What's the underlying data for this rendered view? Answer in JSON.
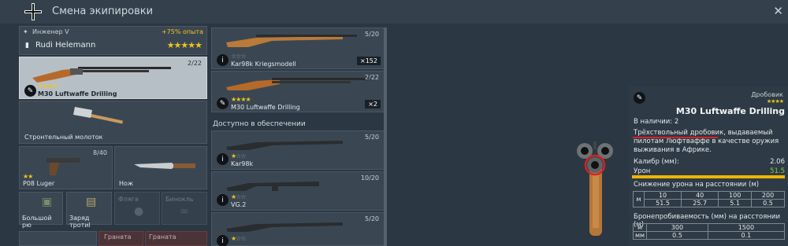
{
  "window": {
    "title": "Смена экипировки"
  },
  "soldier": {
    "role": "Инженер V",
    "exp_bonus": "+75% опыта",
    "name": "Rudi Helemann"
  },
  "loadout": {
    "primary": {
      "name": "M30 Luftwaffe Drilling",
      "ammo": "2/22"
    },
    "melee": {
      "name": "Стронтельный молоток"
    },
    "sidearm": {
      "name": "P08 Luger",
      "ammo": "8/40"
    },
    "knife": {
      "name": "Нож"
    },
    "slots": [
      {
        "name": "Большой рю",
        "icon": "backpack-icon"
      },
      {
        "name": "Заряд тротиl",
        "icon": "explosive-icon"
      },
      {
        "name": "Фляга",
        "icon": "flask-icon"
      },
      {
        "name": "Бинокль",
        "icon": "binoculars-icon"
      }
    ],
    "grenades": [
      "Граната",
      "Граната"
    ]
  },
  "weapon_list": {
    "section_label": "Доступно в обеспечении",
    "items": [
      {
        "name": "Kar98k Kriegsmodell",
        "ammo": "5/20",
        "count": "×152"
      },
      {
        "name": "M30 Luftwaffe Drilling",
        "ammo": "2/22",
        "count": "×2"
      },
      {
        "name": "Kar98k",
        "ammo": "5/20"
      },
      {
        "name": "VG.2",
        "ammo": "10/20"
      },
      {
        "name": "",
        "ammo": "5/20"
      }
    ]
  },
  "details": {
    "type": "Дробовик",
    "name": "M30 Luftwaffe Drilling",
    "stock": "В наличии: 2",
    "description": "Трёхствольный дробовик, выдаваемый пилотам Люфтваффе в качестве оружия выживания в Африке.",
    "caliber_label": "Калибр (мм):",
    "caliber_value": "2.06",
    "damage_label": "Урон",
    "damage_value": "51.5",
    "falloff_title": "Снижение урона на расстоянии (м)",
    "falloff_unit": "м",
    "falloff_distances": [
      "10",
      "40",
      "100",
      "200"
    ],
    "falloff_values": [
      "51.5",
      "25.7",
      "5.1",
      "0.5"
    ],
    "pen_title": "Бронепробиваемость (мм) на расстоянии (м)",
    "pen_unit_m": "м",
    "pen_unit_mm": "мм",
    "pen_distances": [
      "300",
      "1500"
    ],
    "pen_values": [
      "0.5",
      "0.1"
    ]
  },
  "colors": {
    "gold": "#f0c419",
    "damage_bar": "#f0b400",
    "highlight_red": "#d42323"
  }
}
